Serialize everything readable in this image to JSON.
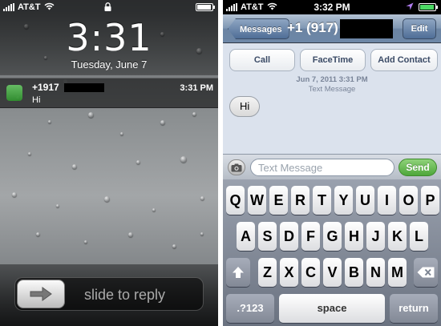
{
  "lock_screen": {
    "status_bar": {
      "carrier": "AT&T"
    },
    "clock": {
      "time": "3:31",
      "date": "Tuesday, June 7"
    },
    "notification": {
      "sender": "+1917",
      "body": "Hi",
      "time": "3:31 PM"
    },
    "slider": {
      "label": "slide to reply"
    }
  },
  "messages": {
    "status_bar": {
      "carrier": "AT&T",
      "time": "3:32 PM"
    },
    "navbar": {
      "back_label": "Messages",
      "title": "+1 (917)",
      "edit_label": "Edit"
    },
    "actions": {
      "call": "Call",
      "facetime": "FaceTime",
      "add_contact": "Add Contact"
    },
    "timestamp": {
      "date": "Jun 7, 2011 3:31 PM",
      "kind": "Text Message"
    },
    "bubble": {
      "text": "Hi"
    },
    "compose": {
      "placeholder": "Text Message",
      "send_label": "Send"
    },
    "keyboard": {
      "row1": [
        "Q",
        "W",
        "E",
        "R",
        "T",
        "Y",
        "U",
        "I",
        "O",
        "P"
      ],
      "row2": [
        "A",
        "S",
        "D",
        "F",
        "G",
        "H",
        "J",
        "K",
        "L"
      ],
      "row3": [
        "Z",
        "X",
        "C",
        "V",
        "B",
        "N",
        "M"
      ],
      "numbers_label": ".?123",
      "space_label": "space",
      "return_label": "return"
    }
  },
  "colors": {
    "send_green": "#4ea73a",
    "battery_green": "#4cd964",
    "nav_blue": "#6d87a7"
  }
}
